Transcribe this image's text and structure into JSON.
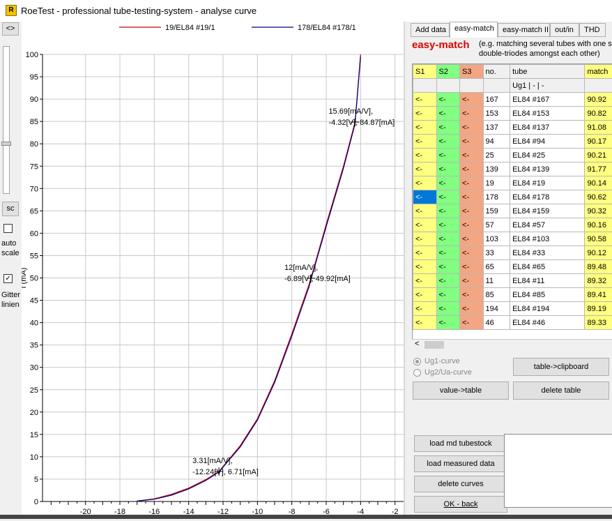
{
  "window": {
    "title": "RoeTest - professional tube-testing-system - analyse curve"
  },
  "toolbar": {
    "collapse_label": "<>",
    "sc_label": "sc",
    "auto_scale_line1": "auto",
    "auto_scale_line2": "scale",
    "grid_check": "✓",
    "grid_line1": "Gitter",
    "grid_line2": "linien"
  },
  "chart_data": {
    "type": "line",
    "xlabel": "",
    "ylabel": "I (mA)",
    "xlim": [
      -22.5,
      -1.5
    ],
    "ylim": [
      0,
      100
    ],
    "xticks": [
      -20,
      -18,
      -16,
      -14,
      -12,
      -10,
      -8,
      -6,
      -4,
      -2
    ],
    "yticks": [
      0,
      5,
      10,
      15,
      20,
      25,
      30,
      35,
      40,
      45,
      50,
      55,
      60,
      65,
      70,
      75,
      80,
      85,
      90,
      95,
      100
    ],
    "grid": true,
    "legend_position": "top",
    "series": [
      {
        "name": "19/EL84 #19/1",
        "color": "#cc0000",
        "x": [
          -17,
          -16,
          -15,
          -14,
          -13,
          -12.24,
          -11,
          -10,
          -9,
          -8,
          -7,
          -6.89,
          -6,
          -5,
          -4.32,
          -4
        ],
        "y": [
          0.1,
          0.6,
          1.6,
          3.0,
          4.9,
          6.71,
          12.5,
          18.5,
          27,
          37.5,
          48.5,
          49.92,
          62,
          75,
          84.87,
          100
        ]
      },
      {
        "name": "178/EL84 #178/1",
        "color": "#000080",
        "x": [
          -17,
          -16,
          -15,
          -14,
          -13,
          -12.24,
          -11,
          -10,
          -9,
          -8,
          -7,
          -6.89,
          -6,
          -5,
          -4.32,
          -4
        ],
        "y": [
          0.1,
          0.5,
          1.4,
          2.8,
          4.7,
          6.6,
          12.2,
          18.2,
          26.6,
          37,
          48,
          49.6,
          61.5,
          74.5,
          84.5,
          99.5
        ]
      }
    ],
    "annotations": [
      {
        "line1": "15.69[mA/V],",
        "line2": "-4.32[V], 84.87[mA]",
        "x": -4.32,
        "y": 84.87
      },
      {
        "line1": "12[mA/V],",
        "line2": "-6.89[V], 49.92[mA]",
        "x": -6.89,
        "y": 49.92
      },
      {
        "line1": "3.31[mA/V],",
        "line2": "-12.24[V], 6.71[mA]",
        "x": -12.24,
        "y": 6.71
      }
    ]
  },
  "tabs": [
    "Add data",
    "easy-match",
    "easy-match II",
    "out/in",
    "THD"
  ],
  "active_tab": 1,
  "panel": {
    "title": "easy-match",
    "note_line1": "(e.g. matching several tubes with one sy",
    "note_line2": "double-triodes amongst each other)"
  },
  "table": {
    "headers": [
      "S1",
      "S2",
      "S3",
      "no.",
      "tube",
      "match"
    ],
    "subheader": [
      "",
      "",
      "",
      "",
      "Ug1 | - | -",
      ""
    ],
    "rows": [
      [
        "<-",
        "<-",
        "<-",
        "167",
        "EL84 #167",
        "90.92"
      ],
      [
        "<-",
        "<-",
        "<-",
        "153",
        "EL84 #153",
        "90.82"
      ],
      [
        "<-",
        "<-",
        "<-",
        "137",
        "EL84 #137",
        "91.08"
      ],
      [
        "<-",
        "<-",
        "<-",
        "94",
        "EL84 #94",
        "90.17"
      ],
      [
        "<-",
        "<-",
        "<-",
        "25",
        "EL84 #25",
        "90.21"
      ],
      [
        "<-",
        "<-",
        "<-",
        "139",
        "EL84 #139",
        "91.77"
      ],
      [
        "<-",
        "<-",
        "<-",
        "19",
        "EL84 #19",
        "90.14"
      ],
      [
        "<-",
        "<-",
        "<-",
        "178",
        "EL84 #178",
        "90.62"
      ],
      [
        "<-",
        "<-",
        "<-",
        "159",
        "EL84 #159",
        "90.32"
      ],
      [
        "<-",
        "<-",
        "<-",
        "57",
        "EL84 #57",
        "90.16"
      ],
      [
        "<-",
        "<-",
        "<-",
        "103",
        "EL84 #103",
        "90.58"
      ],
      [
        "<-",
        "<-",
        "<-",
        "33",
        "EL84 #33",
        "90.12"
      ],
      [
        "<-",
        "<-",
        "<-",
        "65",
        "EL84 #65",
        "89.48"
      ],
      [
        "<-",
        "<-",
        "<-",
        "11",
        "EL84 #11",
        "89.32"
      ],
      [
        "<-",
        "<-",
        "<-",
        "85",
        "EL84 #85",
        "89.41"
      ],
      [
        "<-",
        "<-",
        "<-",
        "194",
        "EL84 #194",
        "89.19"
      ],
      [
        "<-",
        "<-",
        "<-",
        "46",
        "EL84 #46",
        "89.33"
      ]
    ],
    "selected_row": 7,
    "colors": {
      "s1": "#ffff80",
      "s2": "#80ff80",
      "s3": "#f4a582",
      "selected": "#0078d7"
    }
  },
  "curve_mode": {
    "ug1_label": "Ug1-curve",
    "ug2_label": "Ug2/Ua-curve"
  },
  "buttons": {
    "table_clipboard": "table->clipboard",
    "value_table": "value->table",
    "delete_table": "delete table",
    "load_md": "load md tubestock",
    "load_measured": "load measured data",
    "delete_curves": "delete curves",
    "ok_back": "OK - back"
  }
}
